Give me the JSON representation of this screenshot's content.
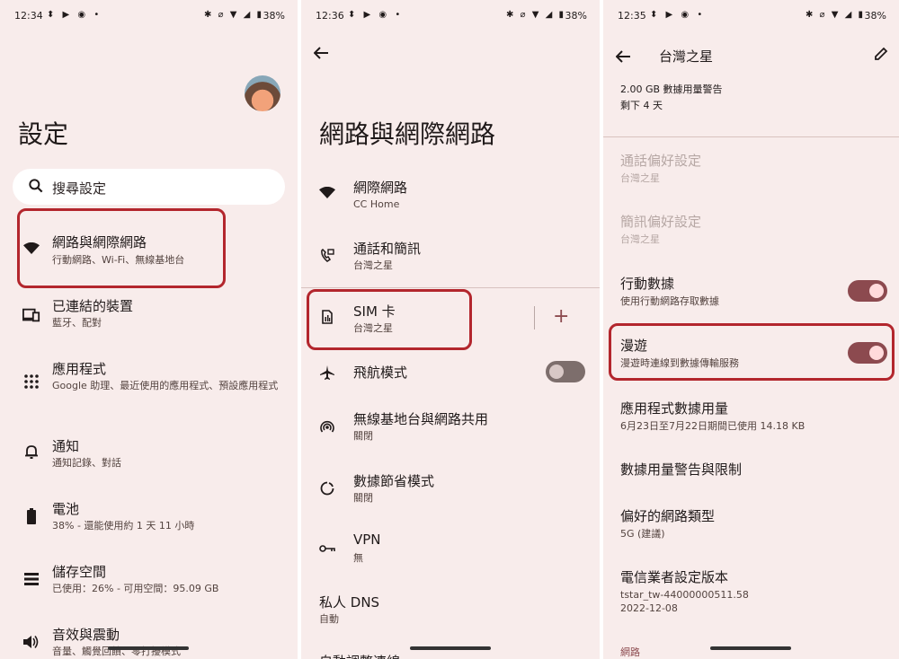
{
  "panel1": {
    "status": {
      "time": "12:34",
      "battery": "38%"
    },
    "title": "設定",
    "search": {
      "placeholder": "搜尋設定"
    },
    "items": [
      {
        "title": "網路與網際網路",
        "sub": "行動網路、Wi-Fi、無線基地台",
        "icon": "wifi-icon"
      },
      {
        "title": "已連結的裝置",
        "sub": "藍牙、配對",
        "icon": "devices-icon"
      },
      {
        "title": "應用程式",
        "sub": "Google 助理、最近使用的應用程式、預設應用程式",
        "icon": "apps-grid-icon"
      },
      {
        "title": "通知",
        "sub": "通知記錄、對話",
        "icon": "bell-icon"
      },
      {
        "title": "電池",
        "sub": "38% - 還能使用約 1 天 11 小時",
        "icon": "battery-icon"
      },
      {
        "title": "儲存空間",
        "sub": "已使用：26% - 可用空間：95.09 GB",
        "icon": "storage-icon"
      },
      {
        "title": "音效與震動",
        "sub": "音量、觸覺回饋、零打擾模式",
        "icon": "volume-icon"
      }
    ]
  },
  "panel2": {
    "status": {
      "time": "12:36",
      "battery": "38%"
    },
    "title": "網路與網際網路",
    "items": [
      {
        "title": "網際網路",
        "sub": "CC Home",
        "icon": "wifi-icon"
      },
      {
        "title": "通話和簡訊",
        "sub": "台灣之星",
        "icon": "call-sms-icon"
      },
      {
        "title": "SIM 卡",
        "sub": "台灣之星",
        "icon": "sim-card-icon"
      },
      {
        "title": "飛航模式",
        "sub": "",
        "icon": "airplane-icon"
      },
      {
        "title": "無線基地台與網路共用",
        "sub": "關閉",
        "icon": "hotspot-icon"
      },
      {
        "title": "數據節省模式",
        "sub": "關閉",
        "icon": "data-saver-icon"
      },
      {
        "title": "VPN",
        "sub": "無",
        "icon": "vpn-key-icon"
      },
      {
        "title": "私人 DNS",
        "sub": "自動",
        "icon": ""
      },
      {
        "title": "自動調整連線",
        "sub": "",
        "icon": ""
      }
    ],
    "plus_label": "+"
  },
  "panel3": {
    "status": {
      "time": "12:35",
      "battery": "38%"
    },
    "title": "台灣之星",
    "warning_line1": "2.00 GB 數據用量警告",
    "warning_line2": "剩下 4 天",
    "items": [
      {
        "title": "通話偏好設定",
        "sub": "台灣之星",
        "disabled": true
      },
      {
        "title": "簡訊偏好設定",
        "sub": "台灣之星",
        "disabled": true
      },
      {
        "title": "行動數據",
        "sub": "使用行動網路存取數據",
        "toggle": true
      },
      {
        "title": "漫遊",
        "sub": "漫遊時連線到數據傳輸服務",
        "toggle": true
      },
      {
        "title": "應用程式數據用量",
        "sub": "6月23日至7月22日期間已使用 14.18 KB"
      },
      {
        "title": "數據用量警告與限制",
        "sub": ""
      },
      {
        "title": "偏好的網路類型",
        "sub": "5G (建議)"
      },
      {
        "title": "電信業者設定版本",
        "sub": "tstar_tw-44000000511.58",
        "sub2": "2022-12-08"
      }
    ],
    "section": "網路"
  },
  "colors": {
    "background": "#f8eceb",
    "accent": "#8c4a4f",
    "highlight": "#b3262d"
  }
}
